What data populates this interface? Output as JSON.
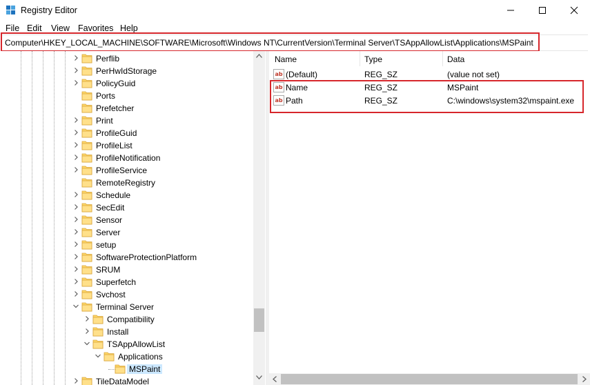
{
  "window": {
    "title": "Registry Editor",
    "minimize_glyph": "—",
    "maximize_glyph": "☐",
    "close_glyph": "✕"
  },
  "menu": [
    "File",
    "Edit",
    "View",
    "Favorites",
    "Help"
  ],
  "address": "Computer\\HKEY_LOCAL_MACHINE\\SOFTWARE\\Microsoft\\Windows NT\\CurrentVersion\\Terminal Server\\TSAppAllowList\\Applications\\MSPaint",
  "tree": [
    {
      "label": "Perflib",
      "level": 0,
      "expander": "collapsed"
    },
    {
      "label": "PerHwIdStorage",
      "level": 0,
      "expander": "collapsed"
    },
    {
      "label": "PolicyGuid",
      "level": 0,
      "expander": "collapsed"
    },
    {
      "label": "Ports",
      "level": 0,
      "expander": "none"
    },
    {
      "label": "Prefetcher",
      "level": 0,
      "expander": "none"
    },
    {
      "label": "Print",
      "level": 0,
      "expander": "collapsed"
    },
    {
      "label": "ProfileGuid",
      "level": 0,
      "expander": "collapsed"
    },
    {
      "label": "ProfileList",
      "level": 0,
      "expander": "collapsed"
    },
    {
      "label": "ProfileNotification",
      "level": 0,
      "expander": "collapsed"
    },
    {
      "label": "ProfileService",
      "level": 0,
      "expander": "collapsed"
    },
    {
      "label": "RemoteRegistry",
      "level": 0,
      "expander": "none"
    },
    {
      "label": "Schedule",
      "level": 0,
      "expander": "collapsed"
    },
    {
      "label": "SecEdit",
      "level": 0,
      "expander": "collapsed"
    },
    {
      "label": "Sensor",
      "level": 0,
      "expander": "collapsed"
    },
    {
      "label": "Server",
      "level": 0,
      "expander": "collapsed"
    },
    {
      "label": "setup",
      "level": 0,
      "expander": "collapsed"
    },
    {
      "label": "SoftwareProtectionPlatform",
      "level": 0,
      "expander": "collapsed"
    },
    {
      "label": "SRUM",
      "level": 0,
      "expander": "collapsed"
    },
    {
      "label": "Superfetch",
      "level": 0,
      "expander": "collapsed"
    },
    {
      "label": "Svchost",
      "level": 0,
      "expander": "collapsed"
    },
    {
      "label": "Terminal Server",
      "level": 0,
      "expander": "expanded"
    },
    {
      "label": "Compatibility",
      "level": 1,
      "expander": "collapsed"
    },
    {
      "label": "Install",
      "level": 1,
      "expander": "collapsed"
    },
    {
      "label": "TSAppAllowList",
      "level": 1,
      "expander": "expanded"
    },
    {
      "label": "Applications",
      "level": 2,
      "expander": "expanded"
    },
    {
      "label": "MSPaint",
      "level": 3,
      "expander": "none",
      "selected": true
    },
    {
      "label": "TileDataModel",
      "level": 0,
      "expander": "collapsed"
    }
  ],
  "columns": {
    "name": "Name",
    "type": "Type",
    "data": "Data"
  },
  "values": [
    {
      "name": "(Default)",
      "type": "REG_SZ",
      "data": "(value not set)"
    },
    {
      "name": "Name",
      "type": "REG_SZ",
      "data": "MSPaint"
    },
    {
      "name": "Path",
      "type": "REG_SZ",
      "data": "C:\\windows\\system32\\mspaint.exe"
    }
  ],
  "value_icon_text": "ab",
  "colors": {
    "highlight_box": "#d6262b",
    "folder": "#ffd868",
    "selection": "#cce8ff"
  }
}
